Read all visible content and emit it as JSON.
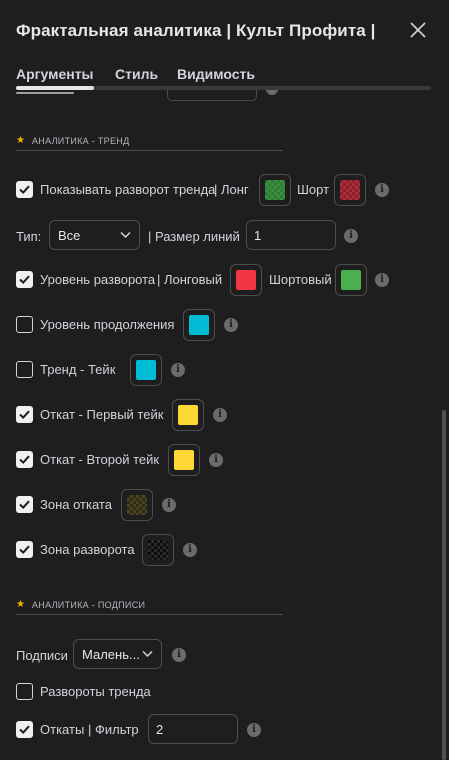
{
  "header": {
    "title": "Фрактальная аналитика | Культ Профита |"
  },
  "tabs": [
    {
      "label": "Аргументы"
    },
    {
      "label": "Стиль"
    },
    {
      "label": "Видимость"
    }
  ],
  "colors": {
    "accent_star": "#f5b400",
    "green": "#4caf50",
    "red": "#f23645",
    "cyan": "#00bcd4",
    "yellow": "#fdd835"
  },
  "section_trend": {
    "star": "★",
    "title": "АНАЛИТИКА - ТРЕНД"
  },
  "show_reversal": {
    "checked": true,
    "label": "Показывать разворот тренда",
    "long_label": "| Лонг",
    "short_label": "Шорт"
  },
  "type_row": {
    "label": "Тип:",
    "value": "Все",
    "line_size_label": "| Размер линий",
    "line_size_value": "1"
  },
  "reversal_level": {
    "checked": true,
    "label": "Уровень разворота",
    "long_label": "| Лонговый",
    "short_label": "Шортовый"
  },
  "continuation_level": {
    "checked": false,
    "label": "Уровень продолжения"
  },
  "trend_take": {
    "checked": false,
    "label": "Тренд - Тейк"
  },
  "pullback_first": {
    "checked": true,
    "label": "Откат - Первый тейк"
  },
  "pullback_second": {
    "checked": true,
    "label": "Откат - Второй тейк"
  },
  "pullback_zone": {
    "checked": true,
    "label": "Зона отката"
  },
  "reversal_zone": {
    "checked": true,
    "label": "Зона разворота"
  },
  "section_labels": {
    "star": "★",
    "title": "АНАЛИТИКА - ПОДПИСИ"
  },
  "labels_row": {
    "label": "Подписи",
    "value": "Малень..."
  },
  "trend_reversals": {
    "checked": false,
    "label": "Развороты тренда"
  },
  "pullbacks": {
    "checked": true,
    "label": "Откаты",
    "filter_label": "| Фильтр",
    "filter_value": "2"
  },
  "info_glyph": "i"
}
